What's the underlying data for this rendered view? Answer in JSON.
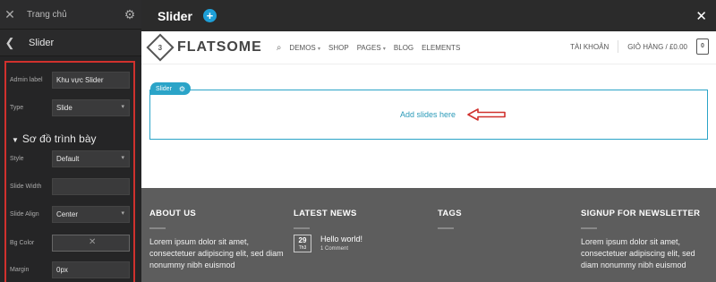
{
  "panel": {
    "home_label": "Trang chủ",
    "close_glyph": "✕",
    "gear_glyph": "⚙",
    "back_glyph": "❮",
    "title": "Slider",
    "options": {
      "admin_label_label": "Admin label",
      "admin_label_value": "Khu vực Slider",
      "type_label": "Type",
      "type_value": "Slide",
      "section_title": "Sơ đồ trình bày",
      "style_label": "Style",
      "style_value": "Default",
      "slide_width_label": "Slide Width",
      "slide_width_value": "",
      "slide_align_label": "Slide Align",
      "slide_align_value": "Center",
      "bg_color_label": "Bg Color",
      "margin_label": "Margin",
      "margin_value": "0px"
    }
  },
  "topbar": {
    "title": "Slider",
    "plus_glyph": "+",
    "close_glyph": "✕"
  },
  "site": {
    "logo_badge": "3",
    "logo_text": "FLATSOME",
    "nav": {
      "demos": "DEMOS",
      "shop": "SHOP",
      "pages": "PAGES",
      "blog": "BLOG",
      "elements": "ELEMENTS"
    },
    "account": "TÀI KHOẢN",
    "cart_label": "GIỎ HÀNG / £0.00",
    "cart_count": "0",
    "slider_tag": "Slider",
    "add_slides": "Add slides here"
  },
  "footer": {
    "about_title": "ABOUT US",
    "about_text": "Lorem ipsum dolor sit amet, consectetuer adipiscing elit, sed diam nonummy nibh euismod",
    "news_title": "LATEST NEWS",
    "news_day": "29",
    "news_month": "Th3",
    "news_post": "Hello world!",
    "news_comments": "1 Comment",
    "tags_title": "TAGS",
    "newsletter_title": "SIGNUP FOR NEWSLETTER",
    "newsletter_text": "Lorem ipsum dolor sit amet, consectetuer adipiscing elit, sed diam nonummy nibh euismod"
  },
  "colors": {
    "accent": "#2ba4c8",
    "highlight_border": "#d0312d",
    "panel_bg": "#252526",
    "footer_bg": "#5d5d5d"
  }
}
